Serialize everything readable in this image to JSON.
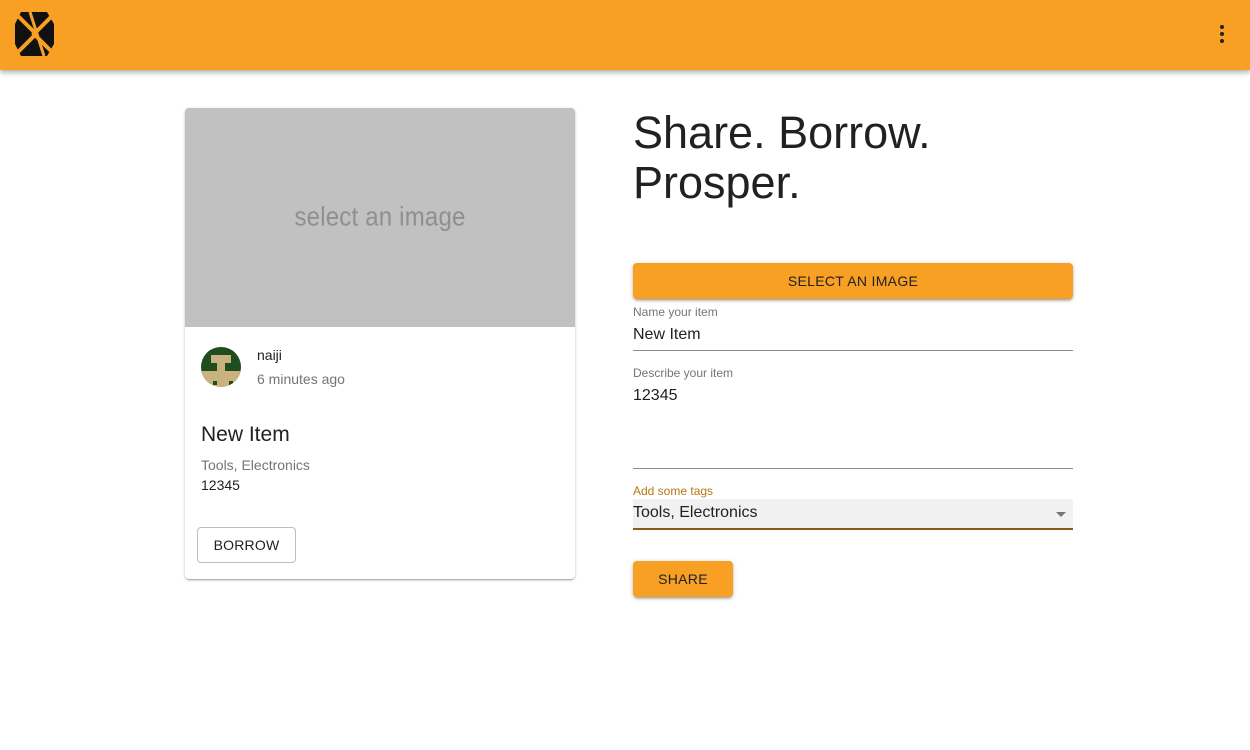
{
  "header": {
    "logo_icon": "boomtown-logo-icon",
    "menu_icon": "more-vert-icon",
    "background_color": "#f7a024"
  },
  "preview_card": {
    "image_placeholder": "select an image",
    "owner": {
      "name": "naiji",
      "avatar_icon": "pixel-avatar"
    },
    "timestamp": "6 minutes ago",
    "title": "New Item",
    "tags": "Tools, Electronics",
    "description": "12345",
    "borrow_label": "BORROW"
  },
  "form": {
    "headline": "Share. Borrow. Prosper.",
    "select_image_label": "SELECT AN IMAGE",
    "name_label": "Name your item",
    "name_value": "New Item",
    "description_label": "Describe your item",
    "description_value": "12345",
    "tags_label": "Add some tags",
    "tags_value": "Tools, Electronics",
    "share_label": "SHARE"
  },
  "colors": {
    "accent": "#f7a024",
    "placeholder_bg": "#c1c1c1",
    "tags_label": "#b5770f"
  }
}
